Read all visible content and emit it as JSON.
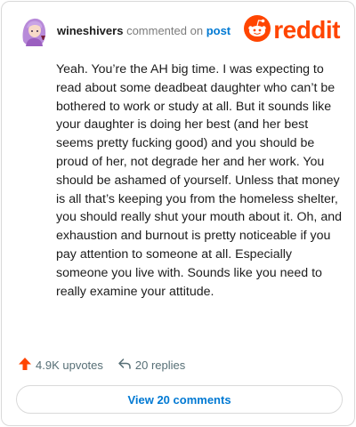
{
  "comment": {
    "username": "wineshivers",
    "action_text": "commented on",
    "post_link": "post",
    "body": "Yeah. You’re the AH big time. I was expecting to read about some deadbeat daughter who can’t be bothered to work or study at all. But it sounds like your daughter is doing her best (and her best seems pretty fucking good) and you should be proud of her, not degrade her and her work. You should be ashamed of yourself. Unless that money is all that’s keeping you from the homeless shelter, you should really shut your mouth about it. Oh, and exhaustion and burnout is pretty noticeable if you pay attention to someone at all. Especially someone you live with. Sounds like you need to really examine your attitude."
  },
  "brand": {
    "wordmark": "reddit",
    "icon": "reddit-snoo-icon",
    "color": "#ff4500"
  },
  "actions": {
    "upvotes": "4.9K upvotes",
    "replies": "20 replies",
    "upvote_icon": "upvote-arrow-icon",
    "reply_icon": "reply-arrow-icon",
    "upvote_color": "#ff4500"
  },
  "view_button": {
    "label": "View 20 comments"
  },
  "colors": {
    "link": "#0079d3",
    "muted": "#7c7c7c",
    "border": "#d9d9d9"
  }
}
